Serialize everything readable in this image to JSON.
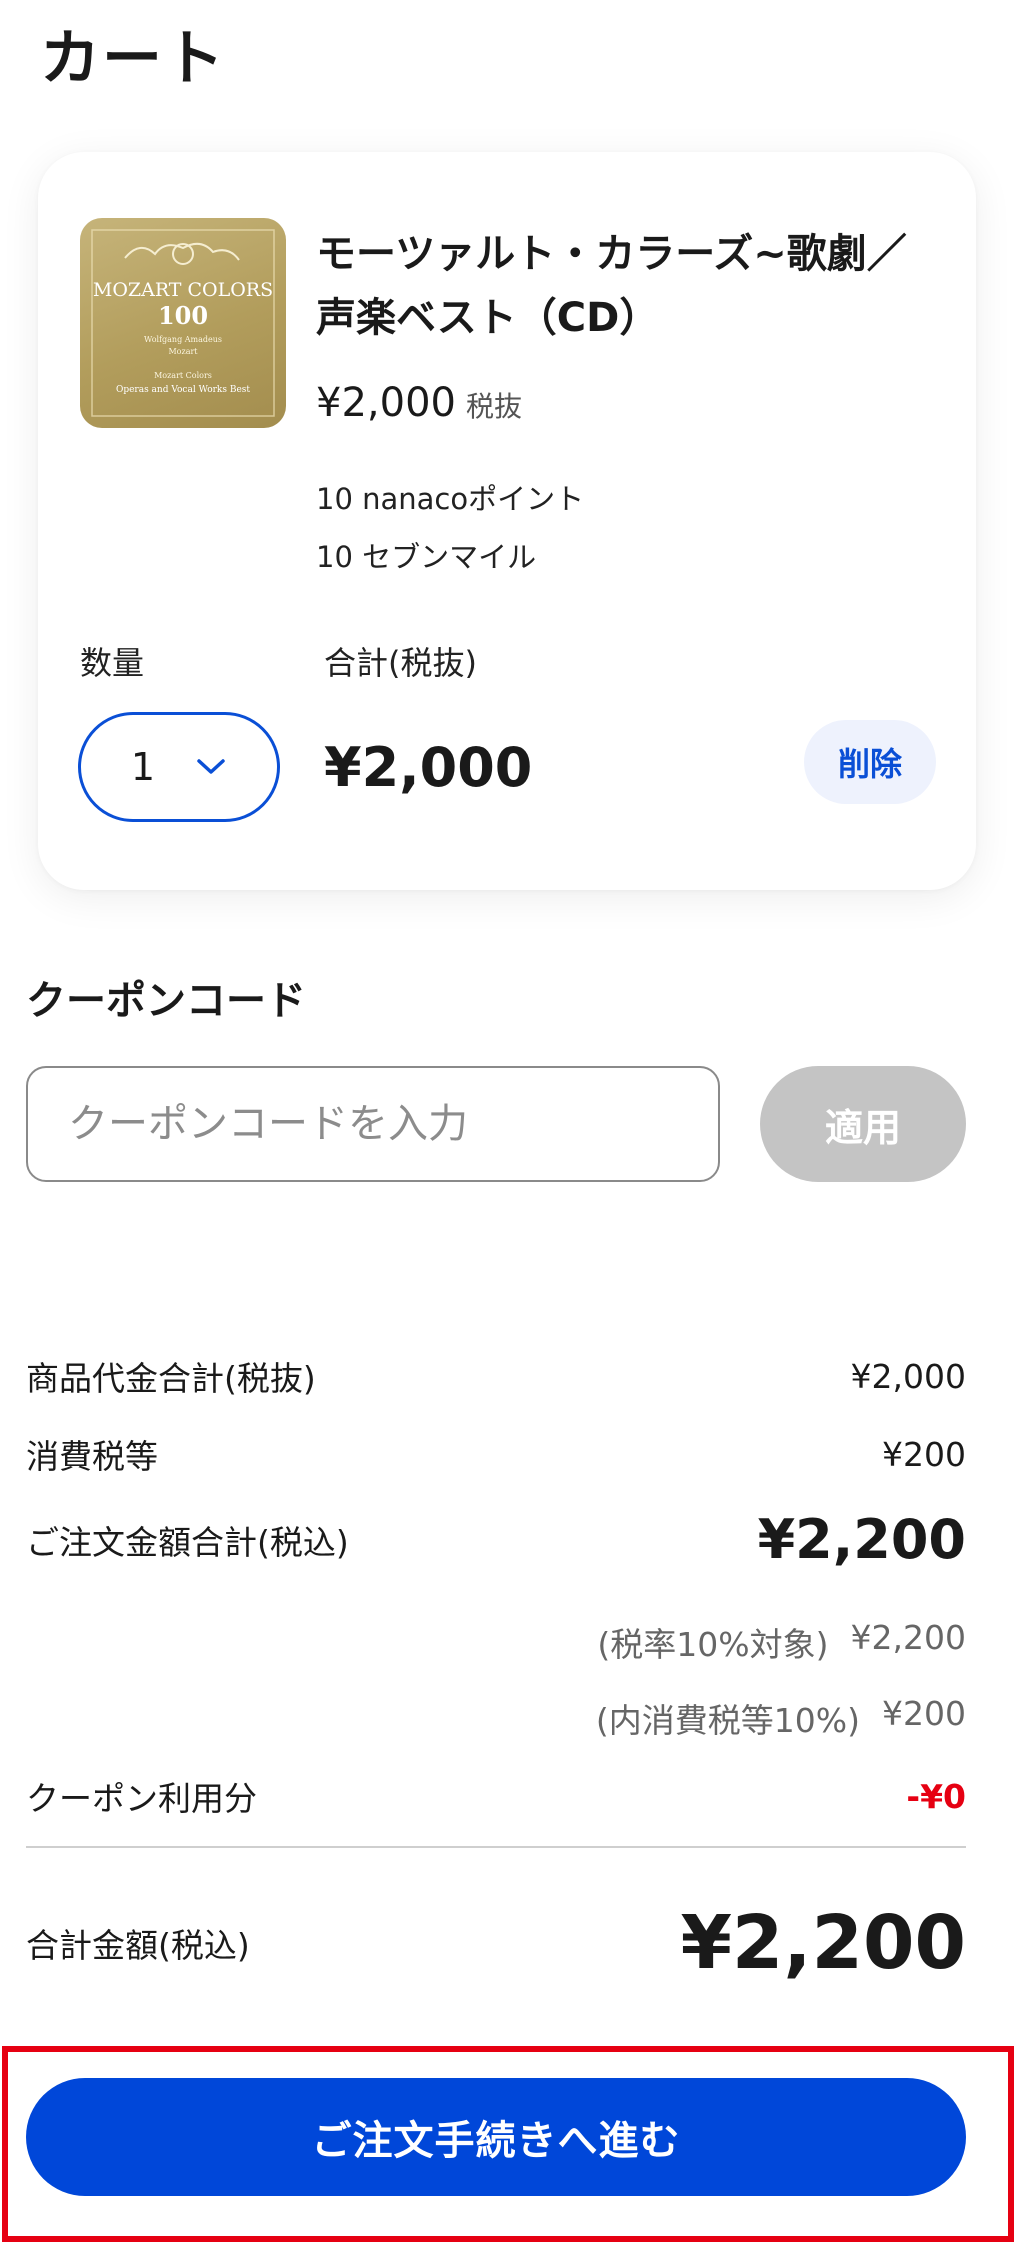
{
  "page": {
    "title": "カート"
  },
  "cart_item": {
    "name": "モーツァルト・カラーズ~歌劇／声楽ベスト（CD）",
    "price": "¥2,000",
    "price_tax_note": "税抜",
    "points": [
      "10 nanacoポイント",
      "10 セブンマイル"
    ],
    "quantity_label": "数量",
    "quantity_value": "1",
    "subtotal_label": "合計(税抜)",
    "subtotal_value": "¥2,000",
    "delete_label": "削除",
    "thumbnail": {
      "lines": [
        "MOZART COLORS",
        "100",
        "Wolfgang Amadeus",
        "Mozart",
        "Mozart Colors",
        "Operas and Vocal Works Best"
      ],
      "background": "#b9a466"
    }
  },
  "coupon": {
    "title": "クーポンコード",
    "placeholder": "クーポンコードを入力",
    "apply_label": "適用"
  },
  "summary": {
    "rows": [
      {
        "label": "商品代金合計(税抜)",
        "value": "¥2,000"
      },
      {
        "label": "消費税等",
        "value": "¥200"
      },
      {
        "label": "ご注文金額合計(税込)",
        "value": "¥2,200"
      }
    ],
    "tax_detail": [
      {
        "label": "(税率10%対象)",
        "value": "¥2,200"
      },
      {
        "label": "(内消費税等10%)",
        "value": "¥200"
      }
    ],
    "coupon_row": {
      "label": "クーポン利用分",
      "value": "-¥0"
    },
    "grand_total": {
      "label": "合計金額(税込)",
      "value": "¥2,200"
    }
  },
  "checkout": {
    "label": "ご注文手続きへ進む"
  },
  "colors": {
    "accent": "#0047d9",
    "danger": "#e60012",
    "disabled": "#c4c4c4",
    "delete_bg": "#eef2fd"
  }
}
